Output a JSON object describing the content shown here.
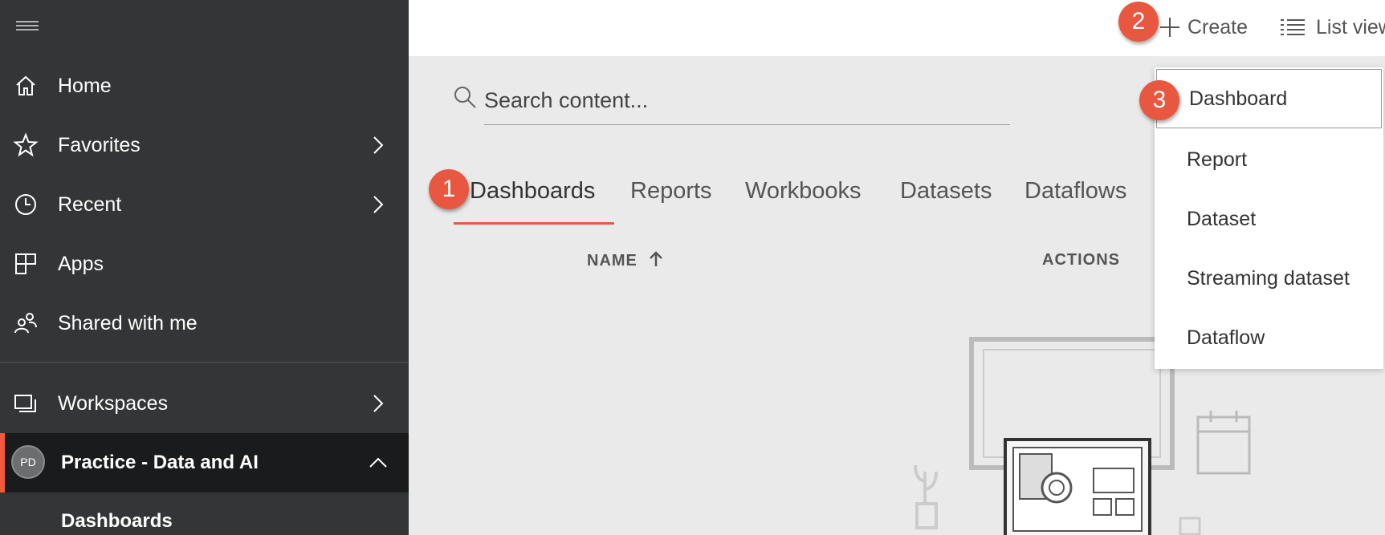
{
  "sidebar": {
    "menu_icon": "hamburger-icon",
    "items": [
      {
        "label": "Home",
        "icon": "home-icon"
      },
      {
        "label": "Favorites",
        "icon": "star-icon"
      },
      {
        "label": "Recent",
        "icon": "clock-icon"
      },
      {
        "label": "Apps",
        "icon": "apps-icon"
      },
      {
        "label": "Shared with me",
        "icon": "shared-users-icon"
      },
      {
        "label": "Workspaces",
        "icon": "workspaces-icon"
      }
    ],
    "workspace": {
      "avatar": "PD",
      "label": "Practice - Data and AI"
    },
    "sub_item": "Dashboards"
  },
  "topbar": {
    "create_label": "Create",
    "list_view_label": "List view"
  },
  "search": {
    "placeholder": "Search content..."
  },
  "tabs": [
    "Dashboards",
    "Reports",
    "Workbooks",
    "Datasets",
    "Dataflows"
  ],
  "columns": {
    "name": "NAME",
    "actions": "ACTIONS"
  },
  "create_menu": [
    "Dashboard",
    "Report",
    "Dataset",
    "Streaming dataset",
    "Dataflow"
  ],
  "badges": [
    "1",
    "2",
    "3"
  ],
  "colors": {
    "sidebar": "#333536",
    "accent": "#e8573f",
    "content_bg": "#eaeaea"
  }
}
